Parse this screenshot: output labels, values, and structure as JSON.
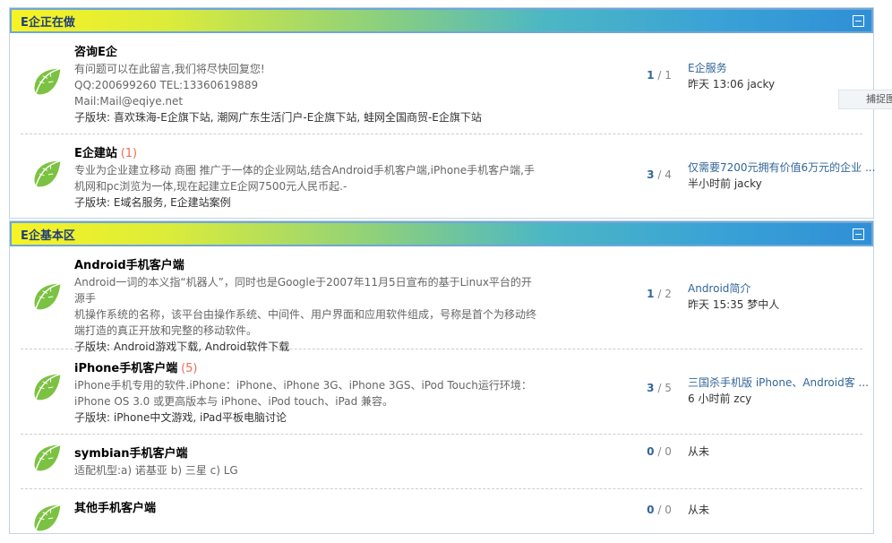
{
  "board1": {
    "title": "E企正在做",
    "forums": [
      {
        "name": "咨询E企",
        "count": "",
        "desc_lines": [
          "有问题可以在此留言,我们将尽快回复您!",
          "QQ:200699260 TEL:13360619889",
          "Mail:Mail@eqiye.net"
        ],
        "sub": "子版块: 喜欢珠海-E企旗下站, 潮网广东生活门户-E企旗下站, 蛙网全国商贸-E企旗下站",
        "threads": "1",
        "posts": "1",
        "last_title": "E企服务",
        "last_meta": "昨天 13:06 jacky"
      },
      {
        "name": "E企建站",
        "count": "(1)",
        "desc_lines": [
          "专业为企业建立移动 商圈 推广于一体的企业网站,结合Android手机客户端,iPhone手机客户端,手",
          "机网和pc浏览为一体,现在起建立E企网7500元人民币起.-"
        ],
        "sub": "子版块: E域名服务, E企建站案例",
        "threads": "3",
        "posts": "4",
        "last_title": "仅需要7200元拥有价值6万元的企业 ...",
        "last_meta": "半小时前 jacky"
      }
    ]
  },
  "board2": {
    "title": "E企基本区",
    "forums": [
      {
        "name": "Android手机客户端",
        "count": "",
        "desc_lines": [
          "Android一词的本义指“机器人”，同时也是Google于2007年11月5日宣布的基于Linux平台的开源手",
          "机操作系统的名称，该平台由操作系统、中间件、用户界面和应用软件组成，号称是首个为移动终",
          "端打造的真正开放和完整的移动软件。"
        ],
        "sub": "子版块: Android游戏下载, Android软件下载",
        "threads": "1",
        "posts": "2",
        "last_title": "Android简介",
        "last_meta": "昨天 15:35 梦中人"
      },
      {
        "name": "iPhone手机客户端",
        "count": "(5)",
        "desc_lines": [
          "iPhone手机专用的软件.iPhone：iPhone、iPhone 3G、iPhone 3GS、iPod Touch运行环境：",
          "iPhone OS 3.0 或更高版本与 iPhone、iPod touch、iPad 兼容。"
        ],
        "sub": "子版块: iPhone中文游戏, iPad平板电脑讨论",
        "threads": "3",
        "posts": "5",
        "last_title": "三国杀手机版 iPhone、Android客 ...",
        "last_meta": "6 小时前 zcy"
      },
      {
        "name": "symbian手机客户端",
        "count": "",
        "desc_lines": [
          "适配机型:a) 诺基亚 b) 三星 c) LG"
        ],
        "sub": "",
        "threads": "0",
        "posts": "0",
        "last_title": "",
        "last_meta": "从未"
      },
      {
        "name": "其他手机客户端",
        "count": "",
        "desc_lines": [],
        "sub": "",
        "threads": "0",
        "posts": "0",
        "last_title": "",
        "last_meta": "从未"
      }
    ]
  },
  "side_tab": "捕捉图",
  "separator": " / ",
  "icons": {
    "forum": "leaf-icon",
    "collapse": "collapse-icon"
  }
}
